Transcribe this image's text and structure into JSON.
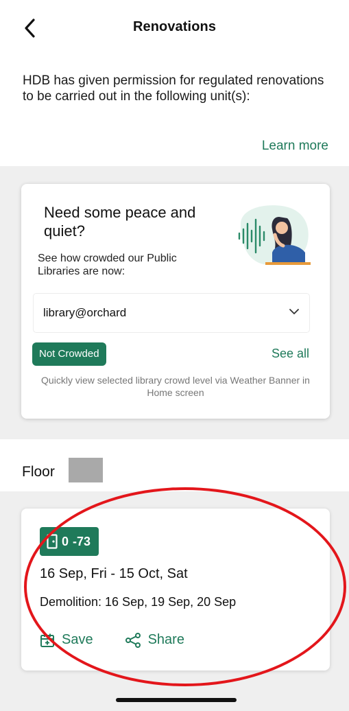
{
  "header": {
    "title": "Renovations"
  },
  "intro": {
    "text": "HDB has given permission for regulated renovations to be carried out in the following unit(s):",
    "learn_more": "Learn more"
  },
  "library_card": {
    "heading": "Need some peace and quiet?",
    "subtext": "See how crowded our Public Libraries are now:",
    "selected_library": "library@orchard",
    "status_badge": "Not Crowded",
    "see_all": "See all",
    "note": "Quickly view selected library crowd level via Weather Banner in Home screen"
  },
  "floor": {
    "label": "Floor"
  },
  "renovation": {
    "unit_start": "0",
    "unit_end": "-73",
    "date_range": "16 Sep, Fri - 15 Oct, Sat",
    "demolition": "Demolition: 16 Sep, 19 Sep, 20 Sep",
    "save_label": "Save",
    "share_label": "Share"
  },
  "colors": {
    "accent": "#1f7a5a",
    "annotation": "#e3161b"
  },
  "icons": [
    "back-arrow-icon",
    "chevron-down-icon",
    "door-icon",
    "calendar-icon",
    "share-icon"
  ]
}
